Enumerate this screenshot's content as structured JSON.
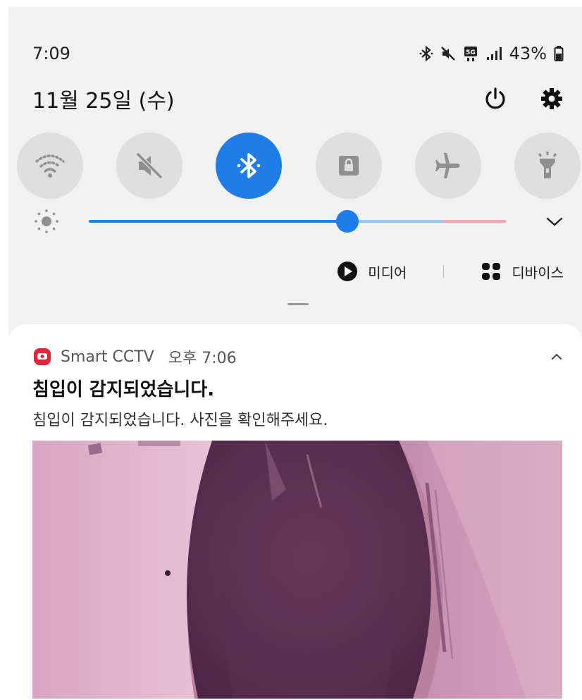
{
  "status_bar": {
    "time": "7:09",
    "battery": "43%"
  },
  "header": {
    "date": "11월 25일 (수)"
  },
  "quick_settings": [
    {
      "name": "wifi",
      "icon": "wifi-icon",
      "active": false
    },
    {
      "name": "sound",
      "icon": "mute-icon",
      "active": false
    },
    {
      "name": "bluetooth",
      "icon": "bluetooth-icon",
      "active": true
    },
    {
      "name": "rotation-lock",
      "icon": "lock-icon",
      "active": false
    },
    {
      "name": "airplane",
      "icon": "airplane-icon",
      "active": false
    },
    {
      "name": "flashlight",
      "icon": "flashlight-icon",
      "active": false
    }
  ],
  "brightness": {
    "level": 0.62
  },
  "media_row": {
    "media_label": "미디어",
    "devices_label": "디바이스"
  },
  "notification": {
    "app_name": "Smart CCTV",
    "time": "오후 7:06",
    "title": "침입이 감지되었습니다.",
    "body": "침입이 감지되었습니다. 사진을 확인해주세요."
  },
  "colors": {
    "accent": "#1e7de8",
    "app_icon": "#e8233b"
  }
}
